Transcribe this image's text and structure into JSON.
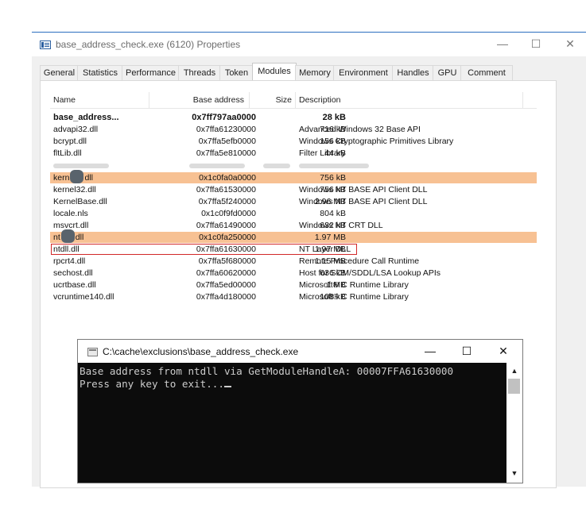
{
  "properties_window": {
    "title": "base_address_check.exe (6120) Properties",
    "minimize": "—",
    "maximize": "☐",
    "close": "✕",
    "tabs": [
      {
        "label": "General"
      },
      {
        "label": "Statistics"
      },
      {
        "label": "Performance"
      },
      {
        "label": "Threads"
      },
      {
        "label": "Token"
      },
      {
        "label": "Modules",
        "active": true
      },
      {
        "label": "Memory"
      },
      {
        "label": "Environment"
      },
      {
        "label": "Handles"
      },
      {
        "label": "GPU"
      },
      {
        "label": "Comment"
      }
    ],
    "modules_list": {
      "columns": [
        "Name",
        "Base address",
        "Size",
        "Description"
      ],
      "rows": [
        {
          "name": "base_address...",
          "base": "0x7ff797aa0000",
          "size": "28 kB",
          "desc": ""
        },
        {
          "name": "advapi32.dll",
          "base": "0x7ffa61230000",
          "size": "716 kB",
          "desc": "Advanced Windows 32 Base API"
        },
        {
          "name": "bcrypt.dll",
          "base": "0x7ffa5efb0000",
          "size": "156 kB",
          "desc": "Windows Cryptographic Primitives Library"
        },
        {
          "name": "fltLib.dll",
          "base": "0x7ffa5e810000",
          "size": "44 kB",
          "desc": "Filter Library"
        },
        {
          "name": "",
          "base": "",
          "size": "",
          "desc": ""
        },
        {
          "name_prefix": "kern",
          "name_suffix": "dll",
          "base": "0x1c0fa0a0000",
          "size": "756 kB",
          "desc": ""
        },
        {
          "name": "kernel32.dll",
          "base": "0x7ffa61530000",
          "size": "756 kB",
          "desc": "Windows NT BASE API Client DLL"
        },
        {
          "name": "KernelBase.dll",
          "base": "0x7ffa5f240000",
          "size": "2.96 MB",
          "desc": "Windows NT BASE API Client DLL"
        },
        {
          "name": "locale.nls",
          "base": "0x1c0f9fd0000",
          "size": "804 kB",
          "desc": ""
        },
        {
          "name": "msvcrt.dll",
          "base": "0x7ffa61490000",
          "size": "632 kB",
          "desc": "Windows NT CRT DLL"
        },
        {
          "name_prefix": "nt",
          "name_suffix": "dll",
          "base": "0x1c0fa250000",
          "size": "1.97 MB",
          "desc": ""
        },
        {
          "name": "ntdll.dll",
          "base": "0x7ffa61630000",
          "size": "1.97 MB",
          "desc": "NT Layer DLL"
        },
        {
          "name": "rpcrt4.dll",
          "base": "0x7ffa5f680000",
          "size": "1.15 MB",
          "desc": "Remote Procedure Call Runtime"
        },
        {
          "name": "sechost.dll",
          "base": "0x7ffa60620000",
          "size": "636 kB",
          "desc": "Host for SCM/SDDL/LSA Lookup APIs"
        },
        {
          "name": "ucrtbase.dll",
          "base": "0x7ffa5ed00000",
          "size": "1 MB",
          "desc": "Microsoft® C Runtime Library"
        },
        {
          "name": "vcruntime140.dll",
          "base": "0x7ffa4d180000",
          "size": "108 kB",
          "desc": "Microsoft® C Runtime Library"
        }
      ],
      "highlight_color": "#f7c193",
      "selection_border_color": "#d22828"
    }
  },
  "console_window": {
    "title": "C:\\cache\\exclusions\\base_address_check.exe",
    "minimize": "—",
    "maximize": "☐",
    "close": "✕",
    "lines": [
      "Base address from ntdll via GetModuleHandleA: 00007FFA61630000",
      "Press any key to exit..."
    ],
    "scroll_up": "▲",
    "scroll_down": "▼"
  }
}
